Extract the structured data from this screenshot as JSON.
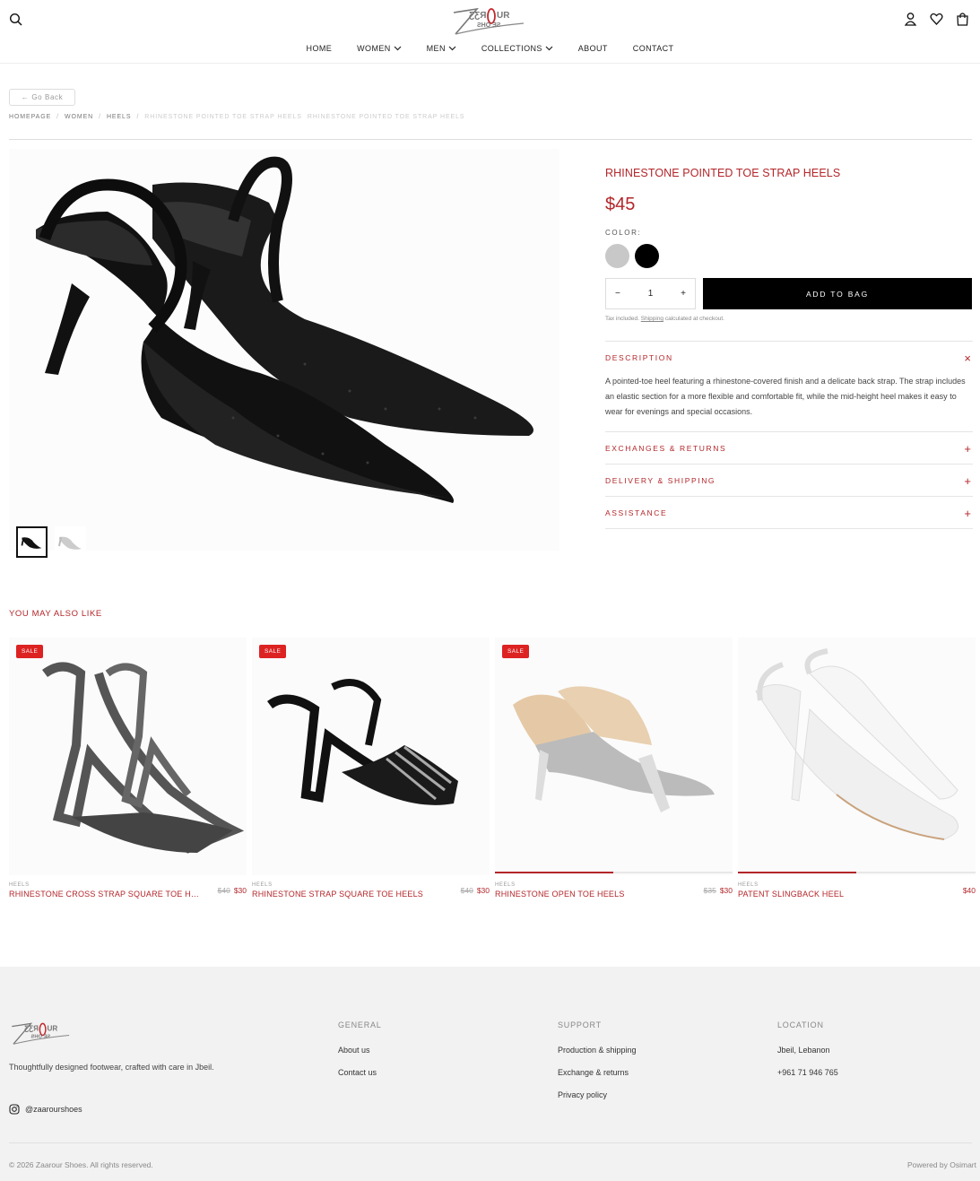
{
  "header": {
    "nav": [
      {
        "label": "HOME",
        "dropdown": false
      },
      {
        "label": "WOMEN",
        "dropdown": true
      },
      {
        "label": "MEN",
        "dropdown": true
      },
      {
        "label": "COLLECTIONS",
        "dropdown": true
      },
      {
        "label": "ABOUT",
        "dropdown": false
      },
      {
        "label": "CONTACT",
        "dropdown": false
      }
    ],
    "icons": [
      "search-icon",
      "account-icon",
      "wishlist-icon",
      "bag-icon"
    ]
  },
  "go_back": "Go Back",
  "breadcrumb": {
    "items": [
      "HOMEPAGE",
      "WOMEN",
      "HEELS",
      "RHINESTONE POINTED TOE STRAP HEELS",
      "RHINESTONE POINTED TOE STRAP HEELS"
    ]
  },
  "product": {
    "name": "RHINESTONE POINTED TOE STRAP HEELS",
    "price": "$45",
    "color_label": "COLOR:",
    "colors": [
      "#c8c8c8",
      "#000000"
    ],
    "quantity": "1",
    "qty_minus": "−",
    "qty_plus": "+",
    "add_to_bag": "ADD TO BAG",
    "tax_prefix": "Tax included. ",
    "tax_link": "Shipping",
    "tax_suffix": " calculated at checkout.",
    "accordion": [
      {
        "title": "DESCRIPTION",
        "sign": "×",
        "open": true,
        "body": "A pointed-toe heel featuring a rhinestone-covered finish and a delicate back strap. The strap includes an elastic section for a more flexible and comfortable fit, while the mid-height heel makes it easy to wear for evenings and special occasions."
      },
      {
        "title": "EXCHANGES & RETURNS",
        "sign": "+",
        "open": false
      },
      {
        "title": "DELIVERY & SHIPPING",
        "sign": "+",
        "open": false
      },
      {
        "title": "ASSISTANCE",
        "sign": "+",
        "open": false
      }
    ]
  },
  "related": {
    "title": "YOU MAY ALSO LIKE",
    "items": [
      {
        "badge": "SALE",
        "category": "HEELS",
        "name": "RHINESTONE CROSS STRAP SQUARE TOE HE...",
        "old_price": "$40",
        "price": "$30"
      },
      {
        "badge": "SALE",
        "category": "HEELS",
        "name": "RHINESTONE STRAP SQUARE TOE HEELS",
        "old_price": "$40",
        "price": "$30"
      },
      {
        "badge": "SALE",
        "category": "HEELS",
        "name": "RHINESTONE OPEN TOE HEELS",
        "old_price": "$35",
        "price": "$30"
      },
      {
        "badge": "",
        "category": "HEELS",
        "name": "PATENT SLINGBACK HEEL",
        "old_price": "",
        "price": "$40"
      }
    ],
    "accent": "#b3262a"
  },
  "footer": {
    "tagline": "Thoughtfully designed footwear, crafted with care in Jbeil.",
    "instagram": "@zaarourshoes",
    "general": {
      "title": "GENERAL",
      "links": [
        "About us",
        "Contact us"
      ]
    },
    "support": {
      "title": "SUPPORT",
      "links": [
        "Production & shipping",
        "Exchange & returns",
        "Privacy policy"
      ]
    },
    "location": {
      "title": "LOCATION",
      "lines": [
        "Jbeil, Lebanon",
        "+961 71 946 765"
      ]
    },
    "copyright": "© 2026 Zaarour Shoes. All rights reserved.",
    "powered": "Powered by Osimart"
  }
}
